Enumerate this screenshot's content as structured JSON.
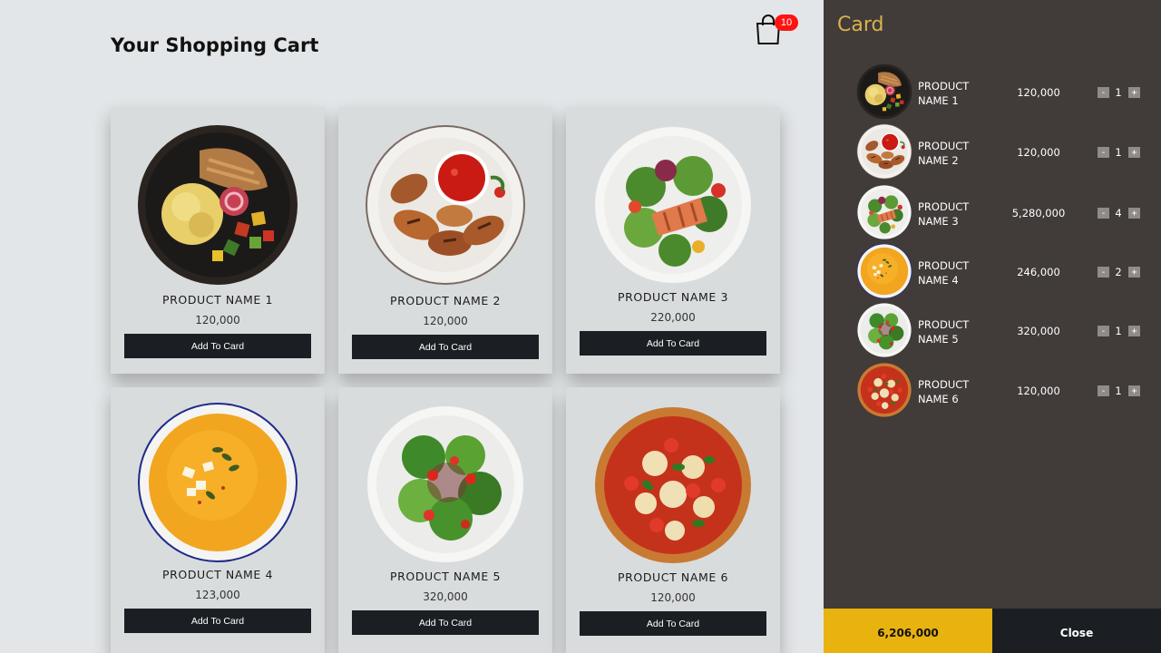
{
  "header": {
    "title": "Your Shopping Cart",
    "cart_count": "10"
  },
  "products": [
    {
      "name": "PRODUCT NAME 1",
      "price": "120,000",
      "button": "Add To Card",
      "icon": "rice-bowl-image"
    },
    {
      "name": "PRODUCT NAME 2",
      "price": "120,000",
      "button": "Add To Card",
      "icon": "chicken-wings-image"
    },
    {
      "name": "PRODUCT NAME 3",
      "price": "220,000",
      "button": "Add To Card",
      "icon": "salmon-salad-image"
    },
    {
      "name": "PRODUCT NAME 4",
      "price": "123,000",
      "button": "Add To Card",
      "icon": "pumpkin-soup-image"
    },
    {
      "name": "PRODUCT NAME 5",
      "price": "320,000",
      "button": "Add To Card",
      "icon": "green-salad-image"
    },
    {
      "name": "PRODUCT NAME 6",
      "price": "120,000",
      "button": "Add To Card",
      "icon": "pizza-image"
    }
  ],
  "sidebar": {
    "title": "Card",
    "items": [
      {
        "name_line1": "PRODUCT",
        "name_line2": "NAME 1",
        "price": "120,000",
        "qty": "1",
        "minus": "-",
        "plus": "+"
      },
      {
        "name_line1": "PRODUCT",
        "name_line2": "NAME 2",
        "price": "120,000",
        "qty": "1",
        "minus": "-",
        "plus": "+"
      },
      {
        "name_line1": "PRODUCT",
        "name_line2": "NAME 3",
        "price": "5,280,000",
        "qty": "4",
        "minus": "-",
        "plus": "+"
      },
      {
        "name_line1": "PRODUCT",
        "name_line2": "NAME 4",
        "price": "246,000",
        "qty": "2",
        "minus": "-",
        "plus": "+"
      },
      {
        "name_line1": "PRODUCT",
        "name_line2": "NAME 5",
        "price": "320,000",
        "qty": "1",
        "minus": "-",
        "plus": "+"
      },
      {
        "name_line1": "PRODUCT",
        "name_line2": "NAME 6",
        "price": "120,000",
        "qty": "1",
        "minus": "-",
        "plus": "+"
      }
    ],
    "total": "6,206,000",
    "close_label": "Close"
  },
  "colors": {
    "background": "#e3e6e8",
    "card": "#d9dcdd",
    "sidebar": "#413b39",
    "accent": "#d8b44a",
    "total_bg": "#e8b30e",
    "button_dark": "#1b1f24",
    "badge": "#ff1212"
  }
}
